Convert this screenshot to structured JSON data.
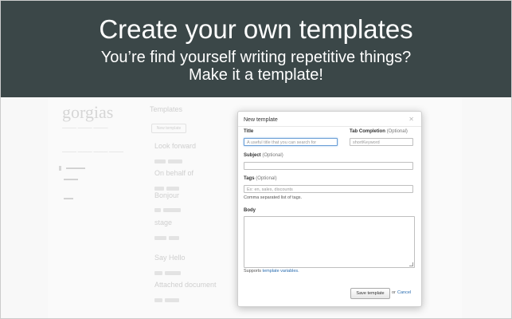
{
  "banner": {
    "headline": "Create your own templates",
    "line1": "You’re find yourself writing repetitive things?",
    "line2": "Make it a template!",
    "background": "#3b4748"
  },
  "background_app": {
    "logo": "gorgias",
    "templates_header": "Templates",
    "new_template_button": "New template",
    "template_items": [
      "Look forward",
      "On behalf of",
      "Bonjour",
      "stage",
      "Say Hello",
      "Attached document"
    ]
  },
  "modal": {
    "title": "New template",
    "close_icon": "close-icon",
    "title_label": "Title",
    "title_placeholder": "A useful title that you can search for",
    "tab_completion_label": "Tab Completion",
    "tab_completion_optional": "(Optional)",
    "tab_completion_placeholder": "shortKeyword",
    "subject_label": "Subject",
    "subject_optional": "(Optional)",
    "subject_value": "",
    "tags_label": "Tags",
    "tags_optional": "(Optional)",
    "tags_placeholder": "Ex: en, sales, discounts",
    "tags_help": "Comma separated list of tags.",
    "body_label": "Body",
    "body_value": "",
    "supports_text": "Supports",
    "supports_link": "template variables.",
    "save_button": "Save template",
    "or_text": "or",
    "cancel_link": "Cancel"
  },
  "colors": {
    "link": "#2a6db0",
    "focus_border": "#6a9ed6"
  }
}
